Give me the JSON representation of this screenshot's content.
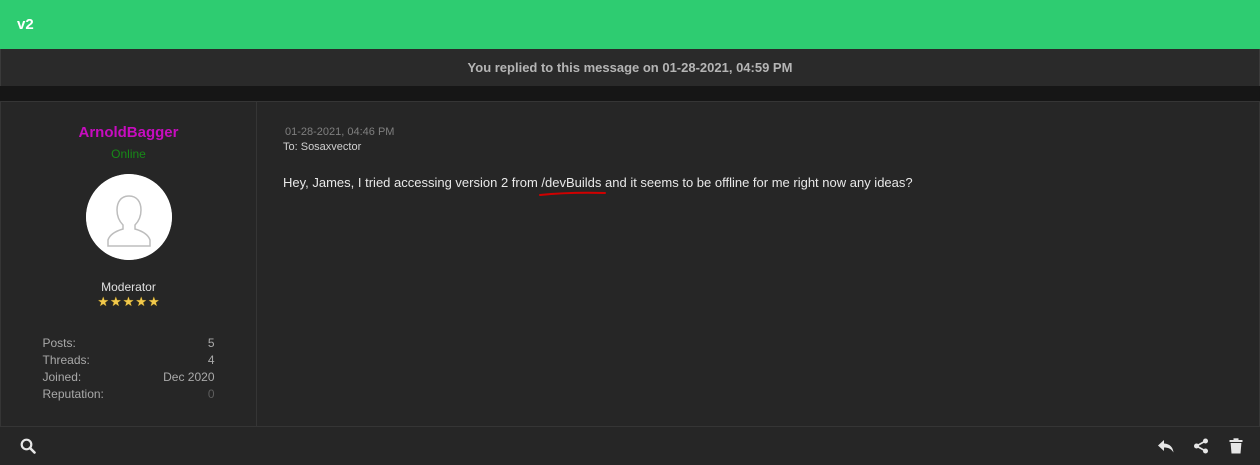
{
  "thread": {
    "title": "v2"
  },
  "notice": {
    "text": "You replied to this message on 01-28-2021, 04:59 PM"
  },
  "author": {
    "username": "ArnoldBagger",
    "status": "Online",
    "role": "Moderator",
    "stars": [
      "★",
      "★",
      "★",
      "★",
      "★"
    ],
    "stats": [
      {
        "label": "Posts:",
        "value": "5"
      },
      {
        "label": "Threads:",
        "value": "4"
      },
      {
        "label": "Joined:",
        "value": "Dec 2020"
      },
      {
        "label": "Reputation:",
        "value": "0"
      }
    ]
  },
  "message": {
    "date": "01-28-2021, 04:46 PM",
    "to": "To: Sosaxvector",
    "body_before": "Hey, James, I tried accessing version 2 from ",
    "body_highlight": "/devBuilds",
    "body_after": " and it seems to be offline for me right now any ideas?"
  },
  "icons": {
    "search": "search-icon",
    "reply": "reply-icon",
    "share": "share-icon",
    "delete": "trash-icon"
  },
  "colors": {
    "header": "#2ecc71",
    "username": "#c70cbf",
    "online": "#178a17",
    "underline": "#d00000"
  }
}
